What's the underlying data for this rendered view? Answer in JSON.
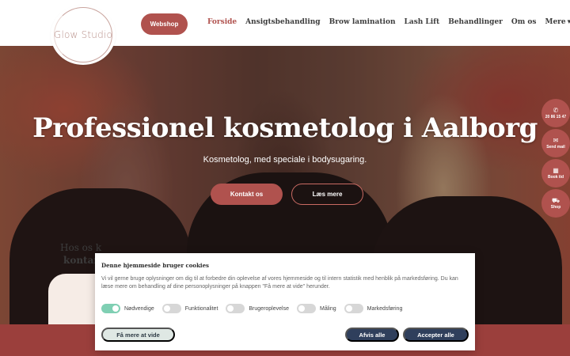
{
  "header": {
    "logo_text": "Glow Studio",
    "webshop_label": "Webshop",
    "nav": [
      {
        "label": "Forside"
      },
      {
        "label": "Ansigtsbehandling"
      },
      {
        "label": "Brow lamination"
      },
      {
        "label": "Lash Lift"
      },
      {
        "label": "Behandlinger"
      },
      {
        "label": "Om os"
      },
      {
        "label": "Mere"
      }
    ],
    "more_caret": "▾"
  },
  "hero": {
    "title": "Professionel kosmetolog i Aalborg",
    "subtitle": "Kosmetolog, med speciale i bodysugaring.",
    "contact_label": "Kontakt os",
    "read_more_label": "Læs mere",
    "card_line1": "Hos os k",
    "card_line2": "kontan"
  },
  "side_buttons": [
    {
      "icon": "phone-icon",
      "glyph": "✆",
      "label": "20 86 15 47"
    },
    {
      "icon": "mail-icon",
      "glyph": "✉",
      "label": "Send mail"
    },
    {
      "icon": "calendar-icon",
      "glyph": "▦",
      "label": "Book tid"
    },
    {
      "icon": "cart-icon",
      "glyph": "⛟",
      "label": "Shop"
    }
  ],
  "cookie": {
    "title": "Denne hjemmeside bruger cookies",
    "text": "Vi vil gerne bruge oplysninger om dig til at forbedre din oplevelse af vores hjemmeside og til intern statistik med henblik på markedsføring. Du kan læse mere om behandling af dine personoplysninger på knappen \"Få mere at vide\" herunder.",
    "toggles": [
      {
        "label": "Nødvendige",
        "on": true
      },
      {
        "label": "Funktionalitet",
        "on": false
      },
      {
        "label": "Brugeroplevelse",
        "on": false
      },
      {
        "label": "Måling",
        "on": false
      },
      {
        "label": "Markedsføring",
        "on": false
      }
    ],
    "more_label": "Få mere at vide",
    "deny_label": "Afvis alle",
    "accept_label": "Accepter alle"
  },
  "colors": {
    "brand": "#b0524e",
    "band": "#9b3f3c",
    "cookie_button": "#2f3f5c",
    "toggle_on": "#7fcfb3"
  }
}
